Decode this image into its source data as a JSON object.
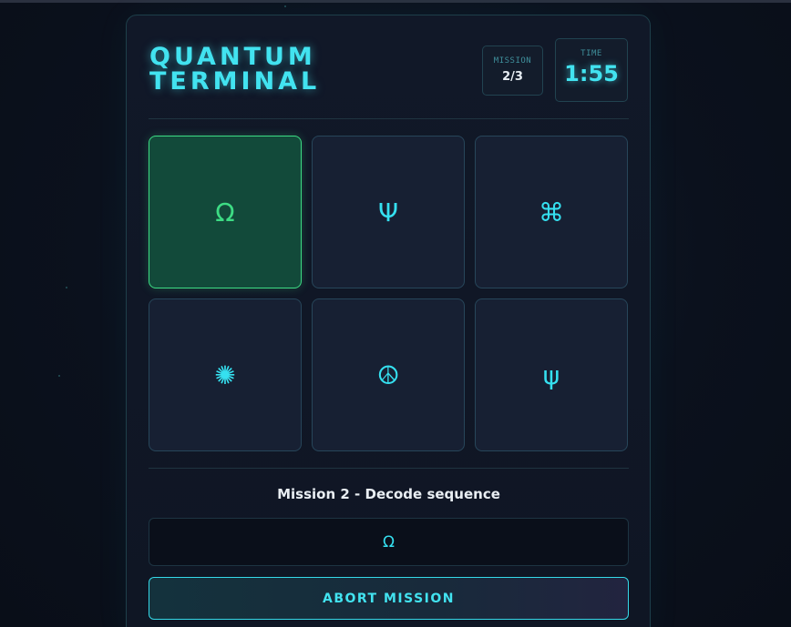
{
  "header": {
    "title_line1": "QUANTUM",
    "title_line2": "TERMINAL",
    "mission_label": "MISSION",
    "mission_value": "2/3",
    "time_label": "TIME",
    "time_value": "1:55"
  },
  "tiles": [
    {
      "symbol": "Ω",
      "icon": "omega-icon",
      "state": "selected"
    },
    {
      "symbol": "Ψ",
      "icon": "psi-icon",
      "state": "idle"
    },
    {
      "symbol": "⌘",
      "icon": "command-icon",
      "state": "idle"
    },
    {
      "symbol": "✺",
      "icon": "sunburst-icon",
      "state": "idle"
    },
    {
      "symbol": "☮",
      "icon": "peace-icon",
      "state": "idle"
    },
    {
      "symbol": "ψ",
      "icon": "small-psi-icon",
      "state": "idle"
    }
  ],
  "mission": {
    "instruction": "Mission 2 - Decode sequence",
    "sequence": "Ω"
  },
  "actions": {
    "abort_label": "ABORT MISSION"
  },
  "colors": {
    "accent": "#42e3f0",
    "selected": "#3ddc84",
    "background": "#0b111d"
  }
}
